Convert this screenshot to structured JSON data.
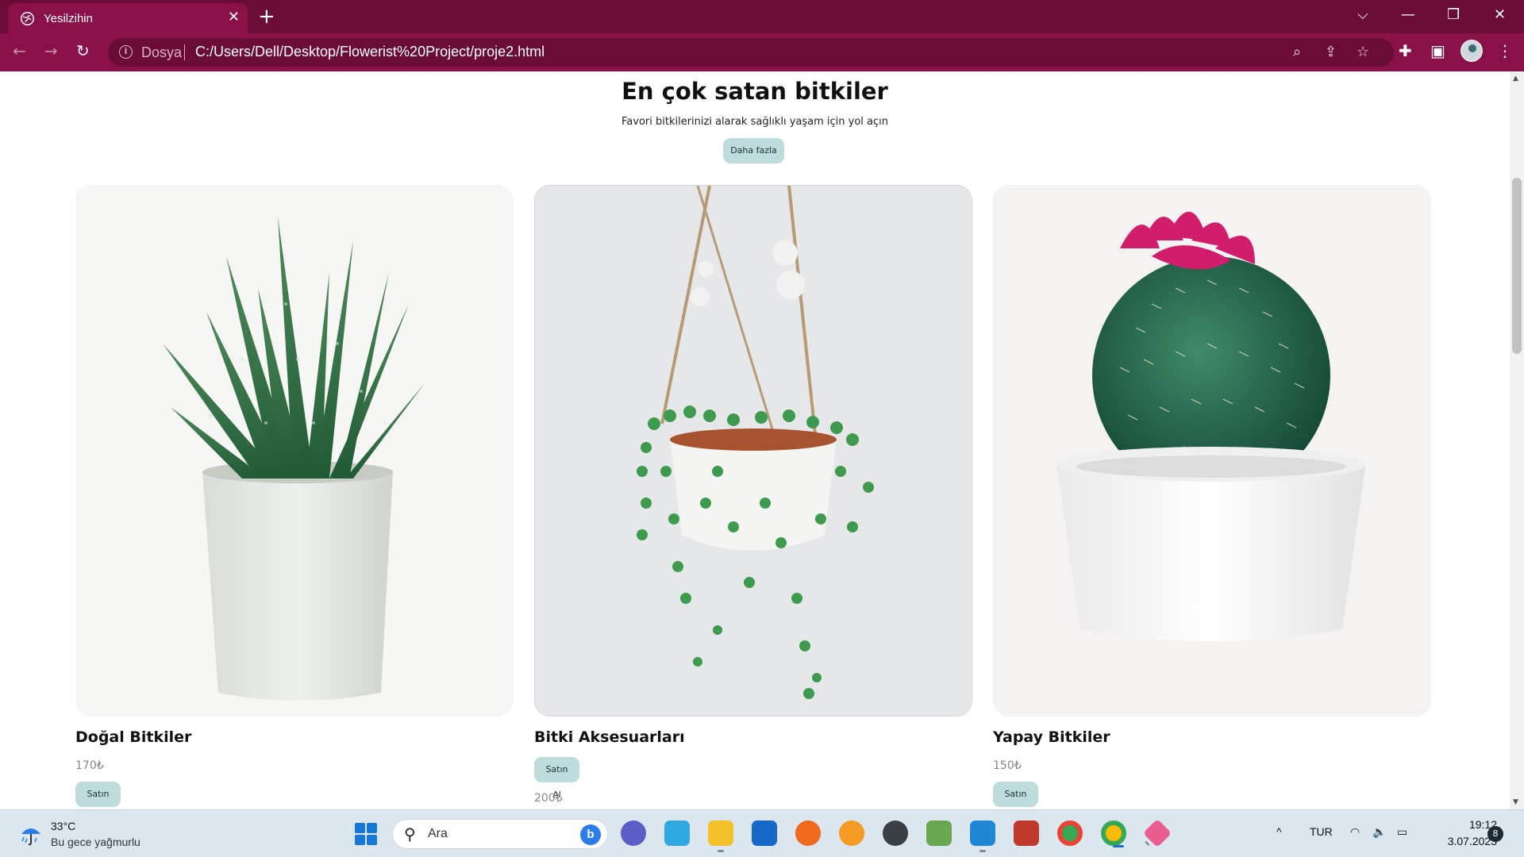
{
  "browser": {
    "tab_title": "Yesilzihin",
    "tab_close": "✕",
    "new_tab": "+",
    "window_controls": {
      "tab_list": "⌵",
      "minimize": "—",
      "restore": "❐",
      "close": "✕"
    },
    "nav": {
      "back": "←",
      "forward": "→",
      "reload": "↻"
    },
    "address": {
      "info": "i",
      "scheme_label": "Dosya",
      "url": "C:/Users/Dell/Desktop/Flowerist%20Project/proje2.html"
    },
    "omni_icons": {
      "zoom": "⌕",
      "share": "⇪",
      "bookmark": "☆"
    },
    "toolbar_icons": {
      "extensions": "✚",
      "side_panel": "▣",
      "menu": "⋮"
    },
    "theme_color": "#8a1148"
  },
  "page": {
    "heading": "En çok satan bitkiler",
    "subheading": "Favori bitkilerinizi alarak sağlıklı yaşam için yol açın",
    "more_button": "Daha fazla",
    "button_color": "#bfdcdc",
    "products": [
      {
        "title": "Doğal Bitkiler",
        "price": "170₺",
        "buy": "Satın Al"
      },
      {
        "title": "Bitki Aksesuarları",
        "price": "200₺",
        "buy": "Satın Al"
      },
      {
        "title": "Yapay Bitkiler",
        "price": "150₺",
        "buy": "Satın Al"
      }
    ]
  },
  "scrollbar": {
    "up": "▲",
    "down": "▼"
  },
  "taskbar": {
    "weather": {
      "temp": "33°C",
      "desc": "Bu gece yağmurlu"
    },
    "search_placeholder": "Ara",
    "search_glass": "⚲",
    "bing": "b",
    "tray": {
      "chevron": "^",
      "language": "TUR",
      "wifi": "◠",
      "volume": "🔈",
      "battery": "▭"
    },
    "clock": {
      "time": "19:12",
      "date": "3.07.2023"
    },
    "notifications": "8"
  }
}
